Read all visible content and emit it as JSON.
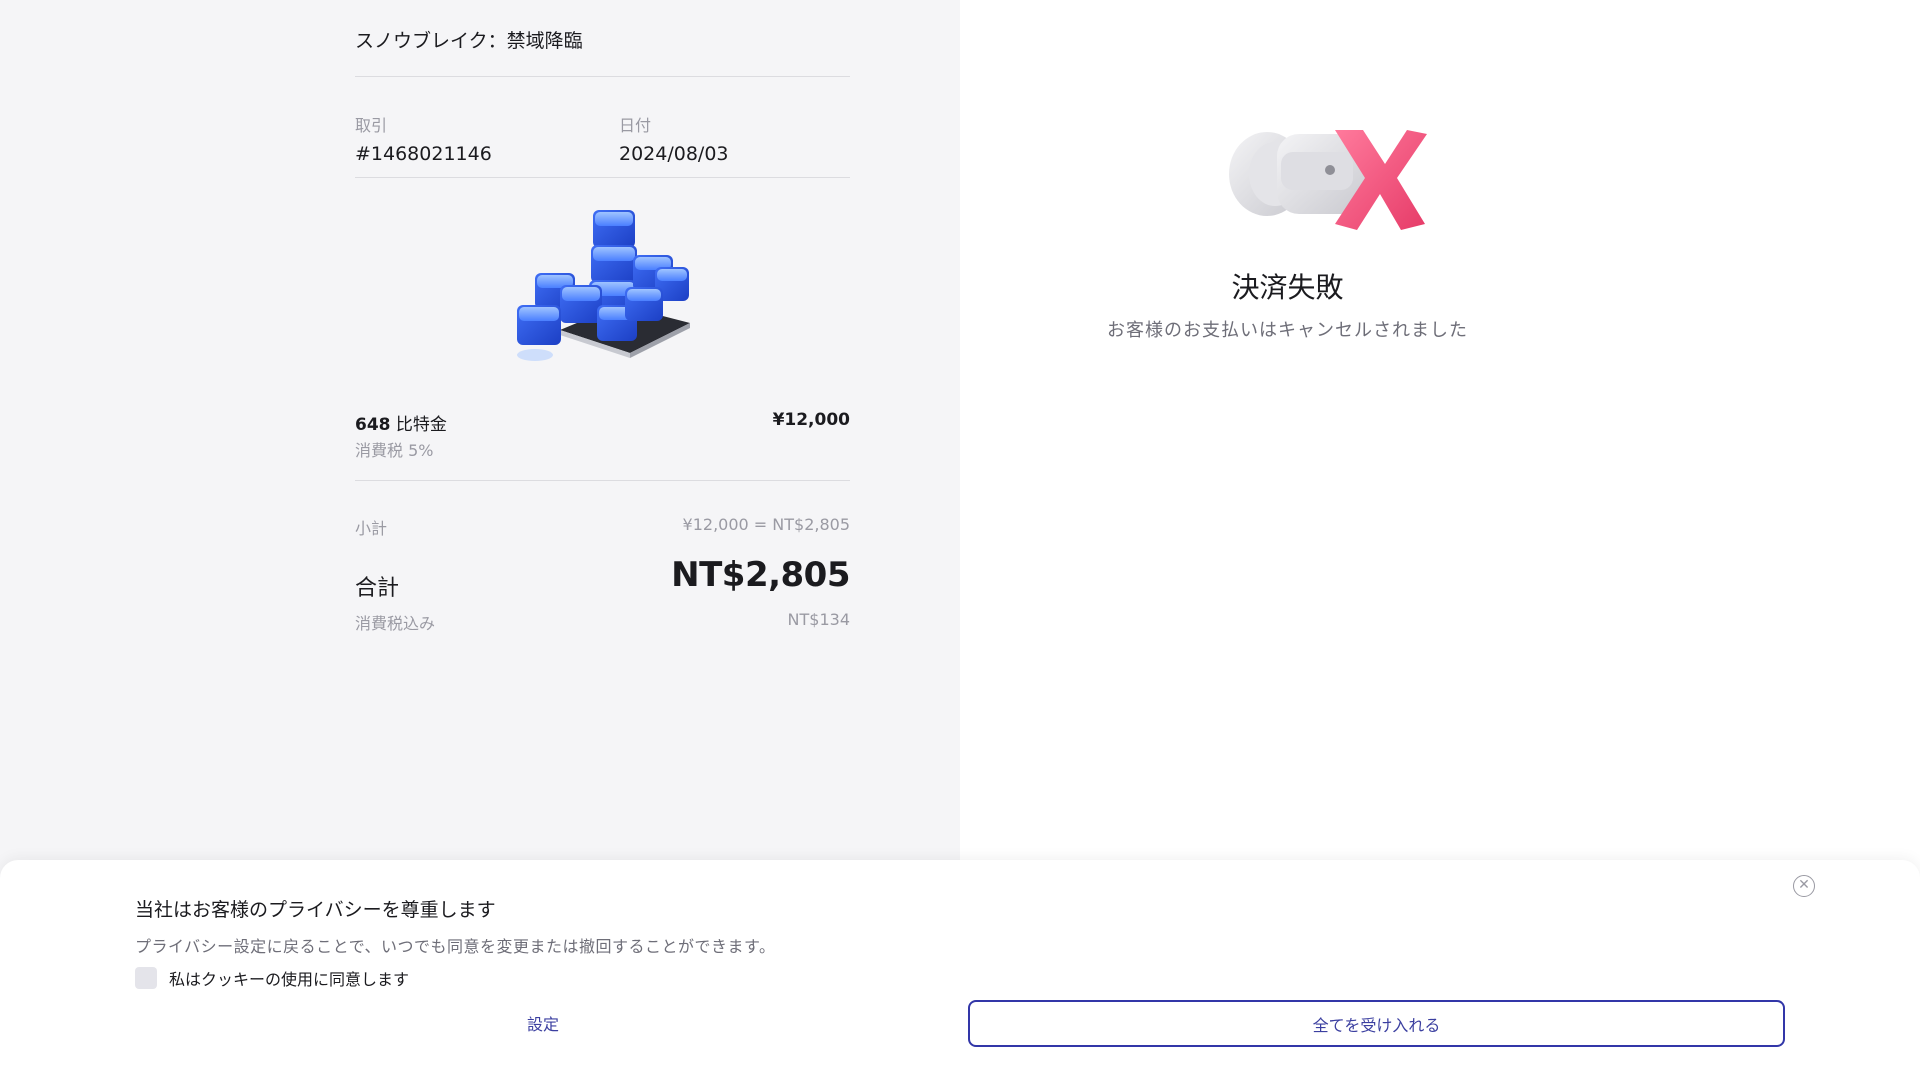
{
  "order": {
    "game_title": "スノウブレイク：禁域降臨",
    "transaction_label": "取引",
    "transaction_value": "#1468021146",
    "date_label": "日付",
    "date_value": "2024/08/03",
    "item_quantity": "648",
    "item_name": "比特金",
    "item_price": "¥12,000",
    "item_tax": "消費税 5%",
    "subtotal_label": "小計",
    "subtotal_value": "¥12,000 = NT$2,805",
    "total_label": "合計",
    "total_value": "NT$2,805",
    "tax_included_label": "消費税込み",
    "tax_included_value": "NT$134"
  },
  "result": {
    "title": "決済失敗",
    "subtitle": "お客様のお支払いはキャンセルされました",
    "icon": "payment-failed-icon"
  },
  "cookie_banner": {
    "title": "当社はお客様のプライバシーを尊重します",
    "description": "プライバシー設定に戻ることで、いつでも同意を変更または撤回することができます。",
    "consent_label": "私はクッキーの使用に同意します",
    "settings_label": "設定",
    "accept_all_label": "全てを受け入れる",
    "close_icon": "close-circle-icon"
  },
  "colors": {
    "accent": "#3236a8",
    "left_panel_bg": "#f5f5f7",
    "fail_pink": "#f0507a"
  }
}
